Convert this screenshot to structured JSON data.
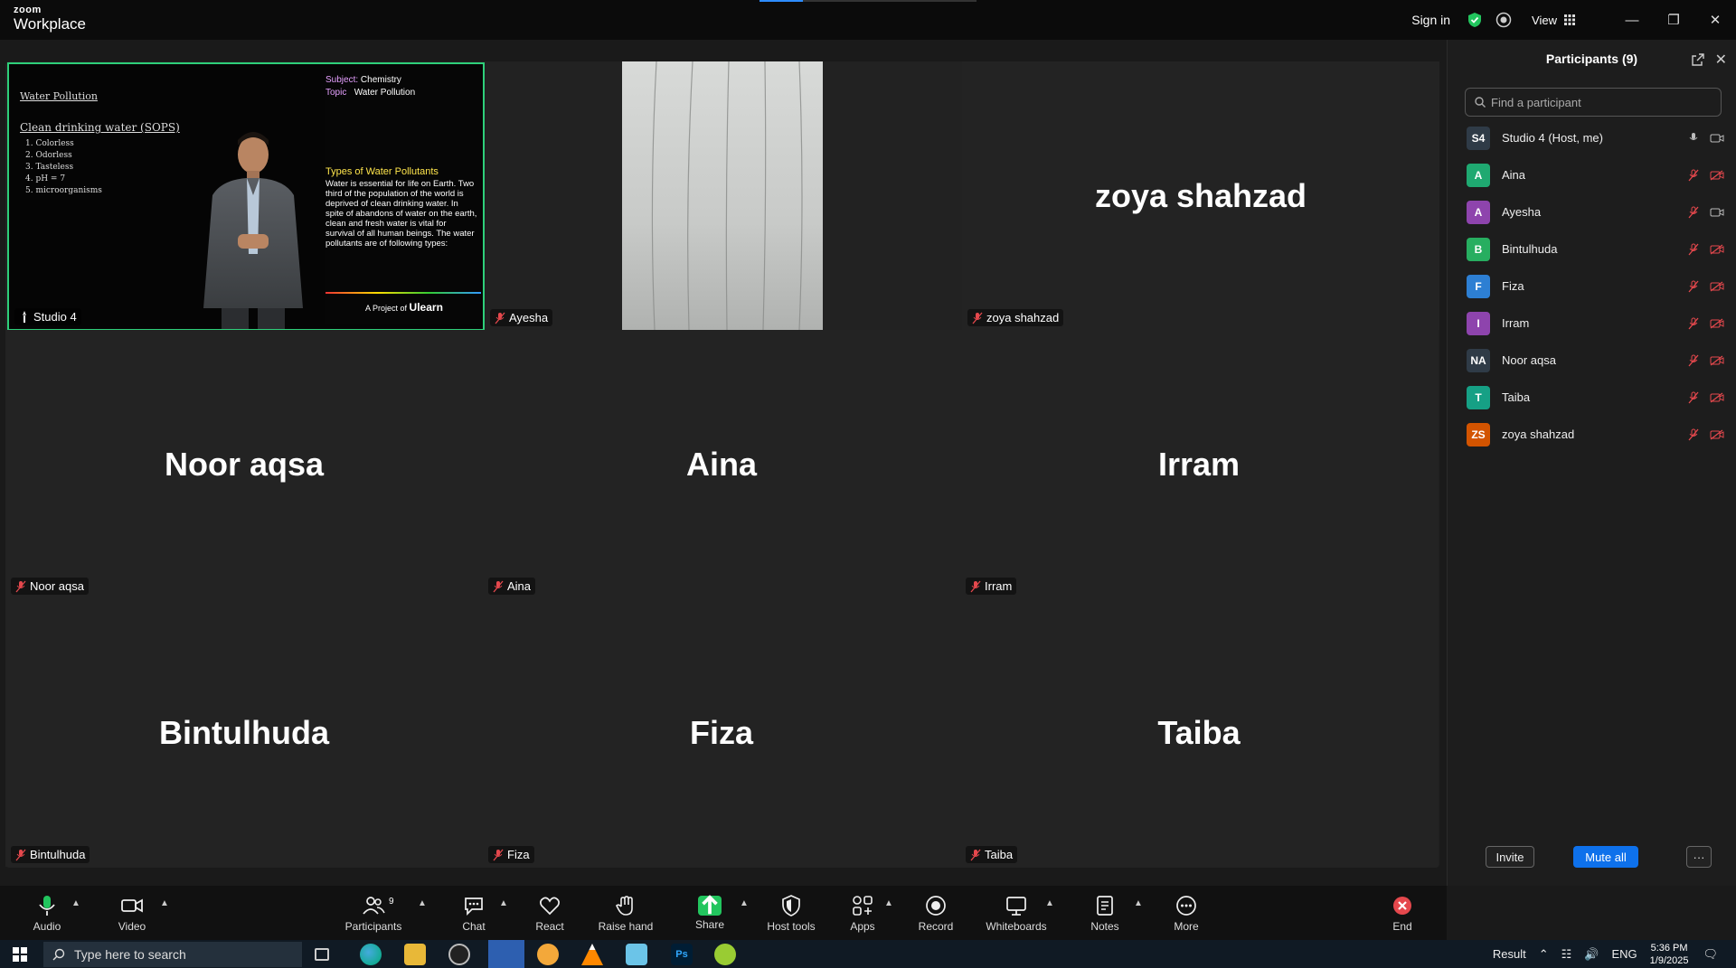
{
  "app": {
    "brand_small": "zoom",
    "brand_name": "Workplace"
  },
  "titlebar": {
    "signin": "Sign in",
    "view": "View"
  },
  "gallery": {
    "tiles": [
      {
        "name": "Studio 4",
        "big": ""
      },
      {
        "name": "Ayesha",
        "big": ""
      },
      {
        "name": "zoya shahzad",
        "big": "zoya shahzad"
      },
      {
        "name": "Noor aqsa",
        "big": "Noor aqsa"
      },
      {
        "name": "Aina",
        "big": "Aina"
      },
      {
        "name": "Irram",
        "big": "Irram"
      },
      {
        "name": "Bintulhuda",
        "big": "Bintulhuda"
      },
      {
        "name": "Fiza",
        "big": "Fiza"
      },
      {
        "name": "Taiba",
        "big": "Taiba"
      }
    ]
  },
  "board": {
    "left_title": "Water Pollution",
    "left_lines": [
      "Clean drinking water (SOPS)",
      "1. Colorless",
      "2. Odorless",
      "3. Tasteless",
      "4. pH = 7",
      "5. microorganisms"
    ],
    "subject_label": "Subject:",
    "subject": "Chemistry",
    "topic_label": "Topic",
    "topic": "Water Pollution",
    "types_title": "Types of Water Pollutants",
    "types_body": "Water is essential for life on Earth. Two third of the population of the world is deprived of clean drinking water. In spite of abandons of water on the earth, clean and fresh water is vital for survival of all human beings. The water pollutants are of following types:",
    "project": "A Project of",
    "project_brand": "Ulearn"
  },
  "panel": {
    "title": "Participants (9)",
    "search_placeholder": "Find a participant",
    "participants": [
      {
        "initials": "S4",
        "name": "Studio 4 (Host, me)",
        "color": "#2f3b47"
      },
      {
        "initials": "A",
        "name": "Aina",
        "color": "#1fa971"
      },
      {
        "initials": "A",
        "name": "Ayesha",
        "color": "#8e44ad"
      },
      {
        "initials": "B",
        "name": "Bintulhuda",
        "color": "#27ae60"
      },
      {
        "initials": "F",
        "name": "Fiza",
        "color": "#2d7fd3"
      },
      {
        "initials": "I",
        "name": "Irram",
        "color": "#8e44ad"
      },
      {
        "initials": "NA",
        "name": "Noor aqsa",
        "color": "#2f3b47"
      },
      {
        "initials": "T",
        "name": "Taiba",
        "color": "#16a085"
      },
      {
        "initials": "ZS",
        "name": "zoya shahzad",
        "color": "#d35400"
      }
    ],
    "invite": "Invite",
    "mute_all": "Mute all",
    "more": "···"
  },
  "toolbar": {
    "audio": "Audio",
    "video": "Video",
    "participants": "Participants",
    "participants_count": "9",
    "chat": "Chat",
    "react": "React",
    "raise_hand": "Raise hand",
    "share": "Share",
    "host_tools": "Host tools",
    "apps": "Apps",
    "record": "Record",
    "whiteboards": "Whiteboards",
    "notes": "Notes",
    "more": "More",
    "end": "End"
  },
  "taskbar": {
    "search": "Type here to search",
    "result": "Result",
    "lang": "ENG",
    "time": "5:36 PM",
    "date": "1/9/2025"
  },
  "colors": {
    "accent": "#0e71eb",
    "active_speaker": "#2ecf7a",
    "muted": "#e5484d",
    "share": "#22c55e",
    "end": "#e5484d"
  }
}
